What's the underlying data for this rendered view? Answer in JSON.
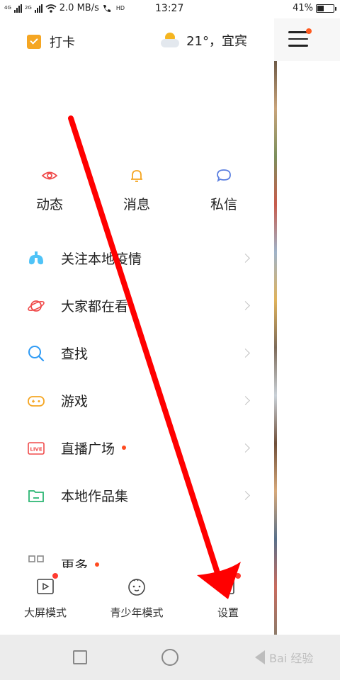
{
  "status_bar": {
    "network_left": "4G",
    "network_right": "2G",
    "speed": "2.0 MB/s",
    "volte": "HD",
    "time": "13:27",
    "battery": "41%",
    "battery_level": 0.41
  },
  "header": {
    "checkin_label": "打卡",
    "weather_text": "21°，宜宾"
  },
  "quick_actions": [
    {
      "label": "动态",
      "icon": "eye-icon",
      "color": "#f04b4b"
    },
    {
      "label": "消息",
      "icon": "bell-icon",
      "color": "#f5a623"
    },
    {
      "label": "私信",
      "icon": "chat-icon",
      "color": "#5b7fe0"
    }
  ],
  "menu": [
    {
      "label": "关注本地疫情",
      "icon": "lungs-icon",
      "color": "#4fc3f7",
      "dot": false
    },
    {
      "label": "大家都在看",
      "icon": "planet-icon",
      "color": "#f04b4b",
      "dot": false
    },
    {
      "label": "查找",
      "icon": "search-icon",
      "color": "#2f9bf5",
      "dot": false
    },
    {
      "label": "游戏",
      "icon": "gamepad-icon",
      "color": "#f5a623",
      "dot": false
    },
    {
      "label": "直播广场",
      "icon": "live-icon",
      "color": "#f04b4b",
      "dot": true
    },
    {
      "label": "本地作品集",
      "icon": "folder-icon",
      "color": "#2bb673",
      "dot": false
    },
    {
      "label": "更多",
      "icon": "grid-icon",
      "color": "#888888",
      "dot": true
    }
  ],
  "bottom_bar": [
    {
      "label": "大屏模式",
      "icon": "play-screen-icon",
      "badge": true
    },
    {
      "label": "青少年模式",
      "icon": "child-face-icon",
      "badge": false
    },
    {
      "label": "设置",
      "icon": "settings-icon",
      "badge": true
    }
  ],
  "watermark": "Bai 经验",
  "colors": {
    "accent_orange": "#ff5a1f",
    "arrow_red": "#ff0000"
  }
}
